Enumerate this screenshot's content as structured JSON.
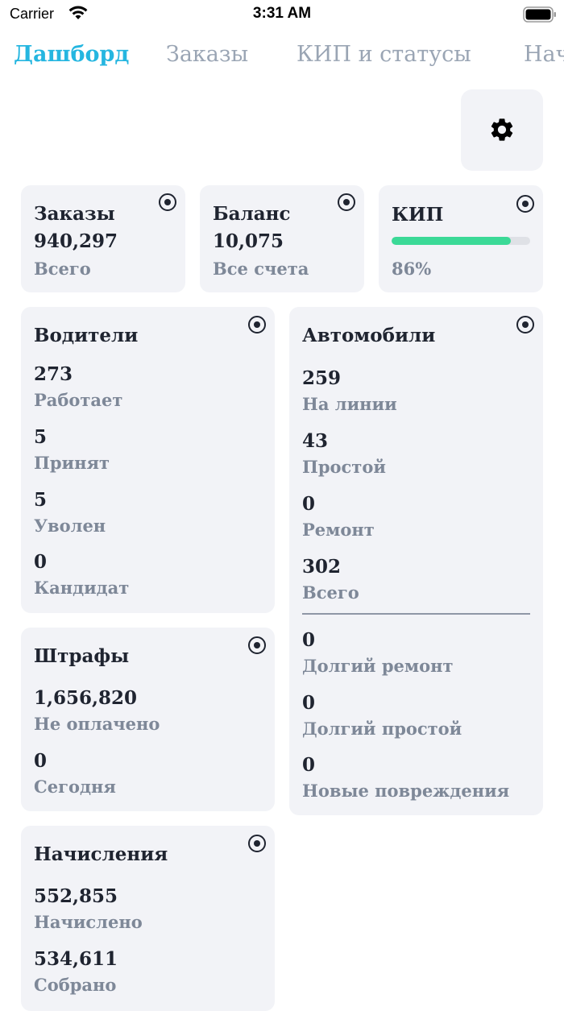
{
  "status_bar": {
    "carrier": "Carrier",
    "time": "3:31 AM"
  },
  "tabs": [
    {
      "label": "Дашборд",
      "active": true
    },
    {
      "label": "Заказы",
      "active": false
    },
    {
      "label": "КИП и статусы",
      "active": false
    },
    {
      "label": "Начисления",
      "active": false
    }
  ],
  "colors": {
    "accent": "#25b6e0",
    "card_bg": "#f2f3f7",
    "progress": "#3bd997",
    "text_primary": "#1f2430",
    "text_secondary": "#7e8898"
  },
  "settings_button": {
    "icon": "gear-icon"
  },
  "cards": {
    "orders": {
      "title": "Заказы",
      "value": "940,297",
      "label": "Всего"
    },
    "balance": {
      "title": "Баланс",
      "value": "10,075",
      "label": "Все счета"
    },
    "kip": {
      "title": "КИП",
      "percent_text": "86%",
      "progress_fraction": 0.86
    },
    "drivers": {
      "title": "Водители",
      "stats": [
        {
          "value": "273",
          "label": "Работает"
        },
        {
          "value": "5",
          "label": "Принят"
        },
        {
          "value": "5",
          "label": "Уволен"
        },
        {
          "value": "0",
          "label": "Кандидат"
        }
      ]
    },
    "cars": {
      "title": "Автомобили",
      "stats": [
        {
          "value": "259",
          "label": "На линии"
        },
        {
          "value": "43",
          "label": "Простой"
        },
        {
          "value": "0",
          "label": "Ремонт"
        },
        {
          "value": "302",
          "label": "Всего"
        }
      ],
      "extra_stats": [
        {
          "value": "0",
          "label": "Долгий ремонт"
        },
        {
          "value": "0",
          "label": "Долгий простой"
        },
        {
          "value": "0",
          "label": "Новые повреждения"
        }
      ]
    },
    "fines": {
      "title": "Штрафы",
      "stats": [
        {
          "value": "1,656,820",
          "label": "Не оплачено"
        },
        {
          "value": "0",
          "label": "Сегодня"
        }
      ]
    },
    "accruals": {
      "title": "Начисления",
      "stats": [
        {
          "value": "552,855",
          "label": "Начислено"
        },
        {
          "value": "534,611",
          "label": "Собрано"
        }
      ]
    }
  }
}
